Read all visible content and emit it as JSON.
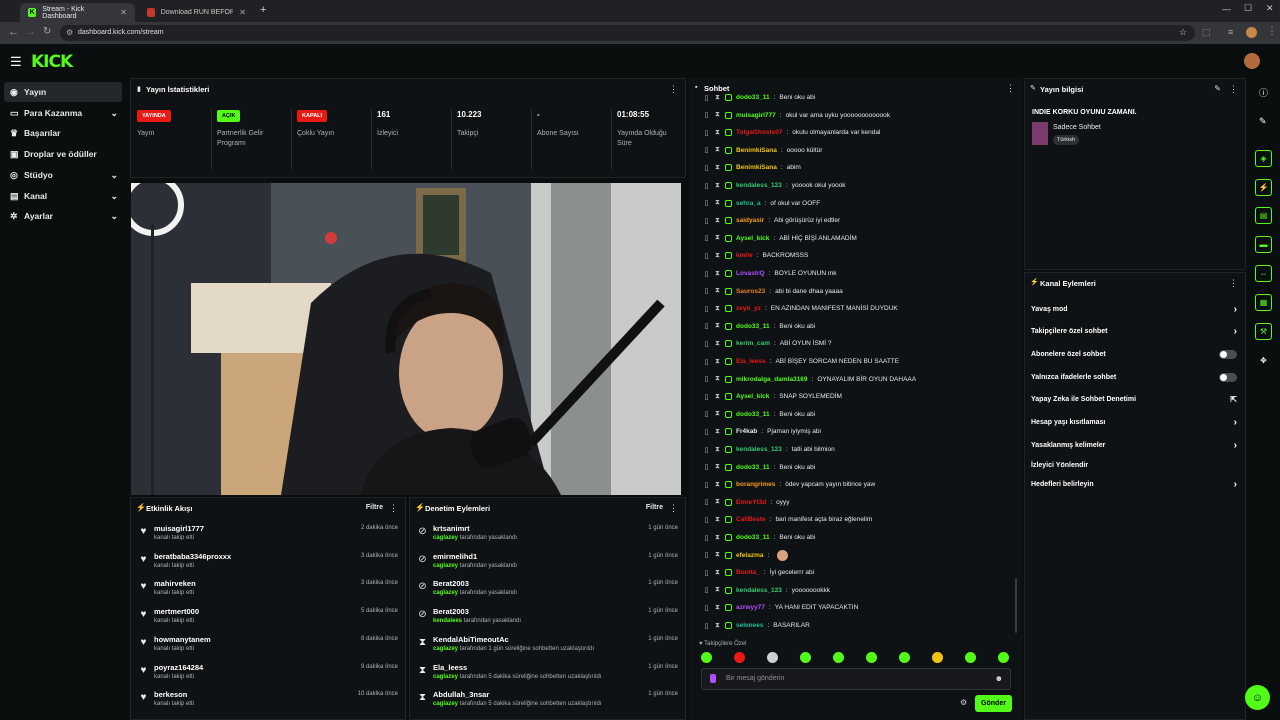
{
  "browser": {
    "tab1_title": "Stream - Kick Dashboard",
    "tab2_title": "Download RUN BEFORE HE KN",
    "url": "dashboard.kick.com/stream"
  },
  "sidebar": {
    "items": [
      {
        "label": "Yayın",
        "icon": "radio-icon"
      },
      {
        "label": "Para Kazanma",
        "icon": "money-icon"
      },
      {
        "label": "Başarılar",
        "icon": "trophy-icon"
      },
      {
        "label": "Droplar ve ödüller",
        "icon": "gift-icon"
      },
      {
        "label": "Stüdyo",
        "icon": "video-icon"
      },
      {
        "label": "Kanal",
        "icon": "tv-icon"
      },
      {
        "label": "Ayarlar",
        "icon": "gear-icon"
      }
    ]
  },
  "stats": {
    "title": "Yayın İstatistikleri",
    "items": [
      {
        "value": "YAYINDA",
        "label": "Yayın"
      },
      {
        "value": "AÇIK",
        "label": "Partnerlik Gelir Programı"
      },
      {
        "value": "KAPALI",
        "label": "Çoklu Yayın"
      },
      {
        "value": "161",
        "label": "İzleyici"
      },
      {
        "value": "10.223",
        "label": "Takipçi"
      },
      {
        "value": "-",
        "label": "Abone Sayısı"
      },
      {
        "value": "01:08:55",
        "label": "Yayında Olduğu Süre"
      }
    ]
  },
  "activity": {
    "title": "Etkinlik Akışı",
    "filter": "Filtre",
    "rows": [
      {
        "name": "muisagirl1777",
        "sub": "kanalı takip etti",
        "time": "2 dakika önce"
      },
      {
        "name": "beratbaba3346proxxx",
        "sub": "kanalı takip etti",
        "time": "3 dakika önce"
      },
      {
        "name": "mahirveken",
        "sub": "kanalı takip etti",
        "time": "3 dakika önce"
      },
      {
        "name": "mertmert000",
        "sub": "kanalı takip etti",
        "time": "5 dakika önce"
      },
      {
        "name": "howmanytanem",
        "sub": "kanalı takip etti",
        "time": "8 dakika önce"
      },
      {
        "name": "poyraz164284",
        "sub": "kanalı takip etti",
        "time": "9 dakika önce"
      },
      {
        "name": "berkeson",
        "sub": "kanalı takip etti",
        "time": "10 dakika önce"
      }
    ]
  },
  "moderation": {
    "title": "Denetim Eylemleri",
    "filter": "Filtre",
    "rows": [
      {
        "name": "krtsanimrt",
        "mod": "caglazey",
        "sub": "tarafından yasaklandı",
        "time": "1 gün önce",
        "icon": "ban-icon"
      },
      {
        "name": "emirmelihd1",
        "mod": "caglazey",
        "sub": "tarafından yasaklandı",
        "time": "1 gün önce",
        "icon": "ban-icon"
      },
      {
        "name": "Berat2003",
        "mod": "caglazey",
        "sub": "tarafından yasaklandı",
        "time": "1 gün önce",
        "icon": "ban-icon"
      },
      {
        "name": "Berat2003",
        "mod": "kendalees",
        "sub": "tarafından yasaklandı",
        "time": "1 gün önce",
        "icon": "ban-icon"
      },
      {
        "name": "KendalAbiTimeoutAc",
        "mod": "caglazey",
        "sub": "tarafından 1 gün süreliğine sohbetten uzaklaştırıldı",
        "time": "1 gün önce",
        "icon": "hourglass-icon"
      },
      {
        "name": "Ela_leess",
        "mod": "caglazey",
        "sub": "tarafından 5 dakika süreliğine sohbetten uzaklaştırıldı",
        "time": "1 gün önce",
        "icon": "hourglass-icon"
      },
      {
        "name": "Abdullah_3nsar",
        "mod": "caglazey",
        "sub": "tarafından 5 dakika süreliğine sohbetten uzaklaştırıldı",
        "time": "1 gün önce",
        "icon": "hourglass-icon"
      }
    ]
  },
  "chat": {
    "title": "Sohbet",
    "followers_only": "Takipçilere Özel",
    "placeholder": "Bir mesaj gönderin",
    "send": "Gönder",
    "messages": [
      {
        "user": "dodo33_11",
        "color": "#53fc18",
        "text": "Beni oku abi"
      },
      {
        "user": "muisagirl777",
        "color": "#53fc18",
        "text": "okul var ama uyku yooooooooooook"
      },
      {
        "user": "TolgaGhosts07",
        "color": "#e91916",
        "text": "okulu olmayanlarda var kendal"
      },
      {
        "user": "BenimkiSana",
        "color": "#f1c40f",
        "text": "ooooo kültür"
      },
      {
        "user": "BenimkiSana",
        "color": "#f1c40f",
        "text": "abim"
      },
      {
        "user": "kendaless_123",
        "color": "#2ecc71",
        "text": "yooook okul yoook"
      },
      {
        "user": "sehra_a",
        "color": "#1abc9c",
        "text": "of okul var OOFF"
      },
      {
        "user": "saidyasir",
        "color": "#f39c12",
        "text": "Abi görüşürüz iyi edtler"
      },
      {
        "user": "Aysel_kick",
        "color": "#53fc18",
        "text": "ABİ HİÇ BİŞİ ANLAMADİM"
      },
      {
        "user": "kmile",
        "color": "#e91916",
        "text": "BACKROMSSS"
      },
      {
        "user": "LovastrQ",
        "color": "#b04dff",
        "text": "BOYLE OYUNUN mk"
      },
      {
        "user": "Sauros23",
        "color": "#e67e22",
        "text": "abi bi dane dhaa yaaaa"
      },
      {
        "user": "zeyn_yz",
        "color": "#e91916",
        "text": "EN AZINDAN MANIFEST MANİSİ DUYDUK"
      },
      {
        "user": "dodo33_11",
        "color": "#53fc18",
        "text": "Beni oku abi"
      },
      {
        "user": "kerim_cam",
        "color": "#2ecc71",
        "text": "ABİ OYUN İSMİ ?"
      },
      {
        "user": "Ela_leess",
        "color": "#e91916",
        "text": "ABİ BİŞEY SORCAM NEDEN BU SAATTE"
      },
      {
        "user": "mikrodalga_damla3169",
        "color": "#53fc18",
        "text": "OYNAYALIM BİR OYUN DAHAAA"
      },
      {
        "user": "Aysel_kick",
        "color": "#53fc18",
        "text": "SNAP SOYLEMEDİM"
      },
      {
        "user": "dodo33_11",
        "color": "#53fc18",
        "text": "Beni oku abi"
      },
      {
        "user": "Fr4kab",
        "color": "#e7e9ea",
        "text": "Pjaman iyiymiş abi"
      },
      {
        "user": "kendaless_123",
        "color": "#2ecc71",
        "text": "tatli abi bilmion"
      },
      {
        "user": "dodo33_11",
        "color": "#53fc18",
        "text": "Beni oku abi"
      },
      {
        "user": "borangrimes",
        "color": "#f39c12",
        "text": "ödev yapcam yayın bitince yaw"
      },
      {
        "user": "EmreYt3d",
        "color": "#e91916",
        "text": "oyyy"
      },
      {
        "user": "CaliBeste",
        "color": "#e91916",
        "text": "bari manifest açta biraz eğlenelim"
      },
      {
        "user": "dodo33_11",
        "color": "#53fc18",
        "text": "Beni oku abi"
      },
      {
        "user": "efelazma",
        "color": "#f1c40f",
        "text": ""
      },
      {
        "user": "Bonita_",
        "color": "#e91916",
        "text": "İyi gecelerrr abi"
      },
      {
        "user": "kendaless_123",
        "color": "#2ecc71",
        "text": "yoooooookkk"
      },
      {
        "user": "azrwyy77",
        "color": "#b04dff",
        "text": "YA HANI EDIT YAPACAKTIN"
      },
      {
        "user": "selenees",
        "color": "#1abc9c",
        "text": "BASARILAR"
      }
    ]
  },
  "info": {
    "title": "Yayın bilgisi",
    "stream_title": "INDIE KORKU OYUNU ZAMANI.",
    "category": "Sadece Sohbet",
    "tag": "Türkish"
  },
  "channel_actions": {
    "title": "Kanal Eylemleri",
    "rows": [
      {
        "label": "Yavaş mod",
        "ctrl": "chevron"
      },
      {
        "label": "Takipçilere özel sohbet",
        "ctrl": "chevron"
      },
      {
        "label": "Abonelere özel sohbet",
        "ctrl": "toggle"
      },
      {
        "label": "Yalnızca ifadelerle sohbet",
        "ctrl": "toggle"
      },
      {
        "label": "Yapay Zeka ile Sohbet Denetimi",
        "ctrl": "external"
      },
      {
        "label": "Hesap yaşı kısıtlaması",
        "ctrl": "chevron"
      },
      {
        "label": "Yasaklanmış kelimeler",
        "ctrl": "chevron"
      },
      {
        "label": "İzleyici Yönlendir",
        "ctrl": "none"
      },
      {
        "label": "Hedefleri belirleyin",
        "ctrl": "chevron"
      }
    ]
  },
  "colors": {
    "accent": "#53fc18",
    "live": "#e91916",
    "bg": "#0b0e0f",
    "panel": "#0f1214"
  }
}
